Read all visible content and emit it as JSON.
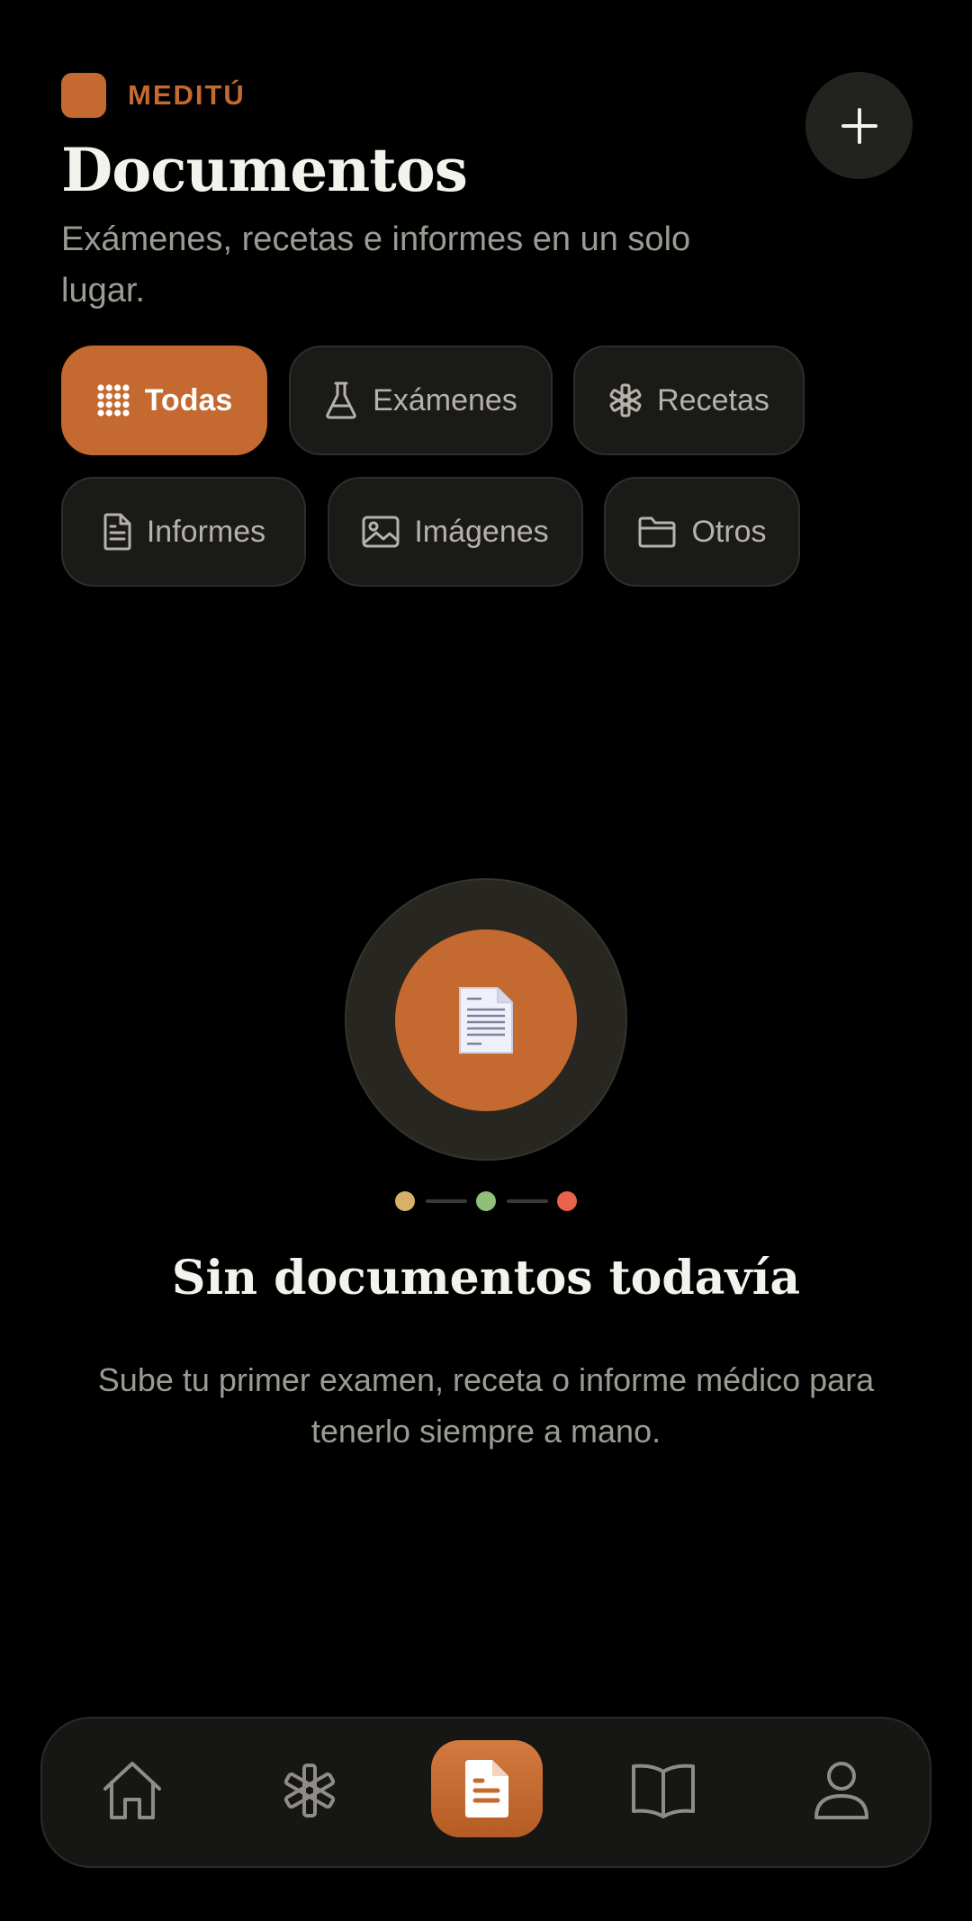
{
  "header": {
    "brand": "MEDITÚ",
    "title": "Documentos",
    "subtitle": "Exámenes, recetas e informes en un solo lugar.",
    "add_icon": "plus-icon"
  },
  "filters": [
    {
      "label": "Todas",
      "icon": "grid-dots-icon",
      "active": true
    },
    {
      "label": "Exámenes",
      "icon": "flask-icon",
      "active": false
    },
    {
      "label": "Recetas",
      "icon": "asterisk-icon",
      "active": false
    },
    {
      "label": "Informes",
      "icon": "document-icon",
      "active": false
    },
    {
      "label": "Imágenes",
      "icon": "image-icon",
      "active": false
    },
    {
      "label": "Otros",
      "icon": "folder-icon",
      "active": false
    }
  ],
  "empty_state": {
    "icon": "page-document-emoji",
    "title": "Sin documentos todavía",
    "text": "Sube tu primer examen, receta o informe médico para tenerlo siempre a mano.",
    "dots": [
      "#d8b067",
      "#8fbf78",
      "#e8634a"
    ]
  },
  "tabbar": {
    "items": [
      {
        "icon": "home-icon",
        "active": false
      },
      {
        "icon": "asterisk-icon",
        "active": false
      },
      {
        "icon": "document-icon",
        "active": true
      },
      {
        "icon": "book-icon",
        "active": false
      },
      {
        "icon": "user-icon",
        "active": false
      }
    ]
  },
  "colors": {
    "accent": "#c4692f",
    "background": "#000000",
    "surface": "#1a1a18"
  }
}
